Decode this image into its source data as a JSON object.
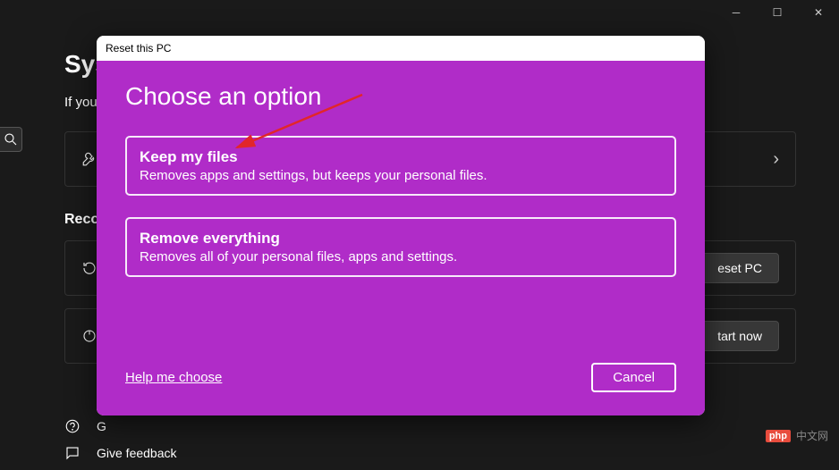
{
  "window": {
    "minimize": "─",
    "maximize": "☐",
    "close": "✕"
  },
  "background": {
    "title_partial": "Sys",
    "subtitle_partial": "If you",
    "section_recovery": "Recove",
    "reset_btn_partial": "eset PC",
    "start_btn_partial": "tart now",
    "help_get_partial": "G",
    "feedback": "Give feedback",
    "chevron": "›"
  },
  "modal": {
    "titlebar": "Reset this PC",
    "heading": "Choose an option",
    "options": [
      {
        "title": "Keep my files",
        "desc": "Removes apps and settings, but keeps your personal files."
      },
      {
        "title": "Remove everything",
        "desc": "Removes all of your personal files, apps and settings."
      }
    ],
    "help_link": "Help me choose",
    "cancel": "Cancel"
  },
  "watermark": {
    "logo": "php",
    "text": "中文网"
  }
}
